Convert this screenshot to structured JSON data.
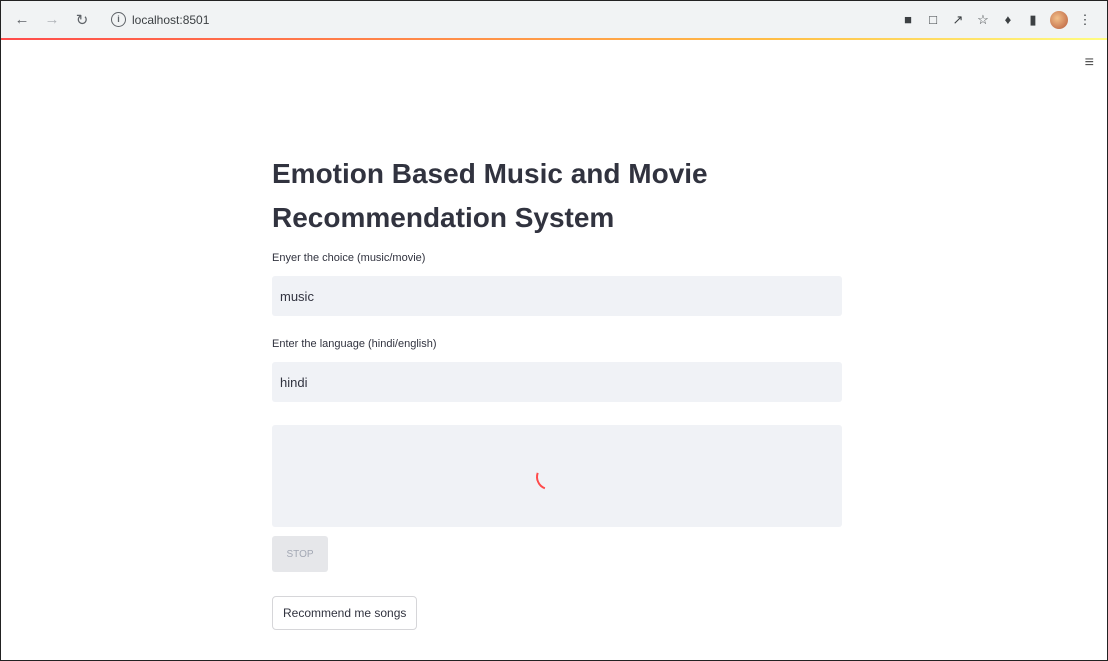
{
  "browser": {
    "url": "localhost:8501",
    "back_icon": "arrow-left-icon",
    "forward_icon": "arrow-right-icon",
    "reload_icon": "reload-icon",
    "info_icon": "info-icon"
  },
  "app": {
    "title": "Emotion Based Music and Movie Recommendation System",
    "choice_label": "Enyer the choice (music/movie)",
    "choice_value": "music",
    "language_label": "Enter the language (hindi/english)",
    "language_value": "hindi",
    "stop_label": "STOP",
    "recommend_label": "Recommend me songs"
  },
  "colors": {
    "accent": "#ff4b4b",
    "input_bg": "#f0f2f6",
    "text": "#31333f"
  }
}
